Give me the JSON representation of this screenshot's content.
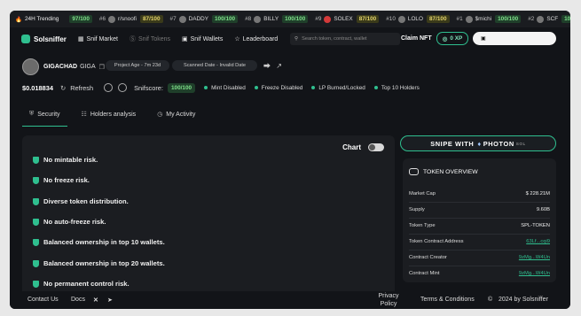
{
  "ticker": {
    "label": "24H Trending",
    "items": [
      {
        "rank": "",
        "name": "",
        "score": "97/100",
        "color": "green"
      },
      {
        "rank": "#6",
        "name": "r/snoofi",
        "score": "87/100",
        "color": "yellow"
      },
      {
        "rank": "#7",
        "name": "DADDY",
        "score": "100/100",
        "color": "green"
      },
      {
        "rank": "#8",
        "name": "BILLY",
        "score": "100/100",
        "color": "green"
      },
      {
        "rank": "#9",
        "name": "SOLEX",
        "score": "87/100",
        "color": "yellow"
      },
      {
        "rank": "#10",
        "name": "LOLO",
        "score": "87/100",
        "color": "yellow"
      },
      {
        "rank": "#1",
        "name": "$michi",
        "score": "100/100",
        "color": "green"
      },
      {
        "rank": "#2",
        "name": "SCF",
        "score": "100/100",
        "color": "green"
      }
    ]
  },
  "nav": {
    "logo": "Solsniffer",
    "market": "Snif Market",
    "tokens": "Snif Tokens",
    "wallets": "Snif Wallets",
    "leaderboard": "Leaderboard",
    "search_placeholder": "Search token, contract, wallet",
    "claim": "Claim NFT",
    "xp": "0 XP"
  },
  "token": {
    "name": "GIGACHAD",
    "symbol": "GIGA",
    "age": "Project Age - 7m 23d",
    "scanned": "Scanned Date - Invalid Date",
    "price": "$0.018834",
    "refresh": "Refresh",
    "snifscore_label": "Snifscore:",
    "snifscore": "100/100",
    "flags": [
      "Mint Disabled",
      "Freeze Disabled",
      "LP Burned/Locked",
      "Top 10 Holders"
    ]
  },
  "tabs": [
    "Security",
    "Holders analysis",
    "My Activity"
  ],
  "panel": {
    "chart_label": "Chart",
    "risks": [
      "No mintable risk.",
      "No freeze risk.",
      "Diverse token distribution.",
      "No auto-freeze risk.",
      "Balanced ownership in top 10 wallets.",
      "Balanced ownership in top 20 wallets.",
      "No permanent control risk."
    ]
  },
  "snipe": {
    "label": "SNIPE WITH",
    "brand": "PHOTON",
    "sub": "SOL"
  },
  "overview": {
    "title": "TOKEN OVERVIEW",
    "rows": [
      {
        "label": "Market Cap",
        "value": "$ 228.21M",
        "link": false
      },
      {
        "label": "Supply",
        "value": "9.60B",
        "link": false
      },
      {
        "label": "Token Type",
        "value": "SPL-TOKEN",
        "link": false
      },
      {
        "label": "Token Contract Address",
        "value": "63Lf...cqi9",
        "link": true
      },
      {
        "label": "Contract Creator",
        "value": "9zMg...W4Un",
        "link": true
      },
      {
        "label": "Contract Mint",
        "value": "9zMg...W4Un",
        "link": true
      }
    ]
  },
  "footer": {
    "contact": "Contact Us",
    "docs": "Docs",
    "privacy": "Privacy Policy",
    "terms": "Terms & Conditions",
    "copyright": "2024 by Solsniffer"
  },
  "colors": {
    "accent": "#2fbf8f",
    "background": "#121418",
    "panel": "#1b1d21"
  }
}
